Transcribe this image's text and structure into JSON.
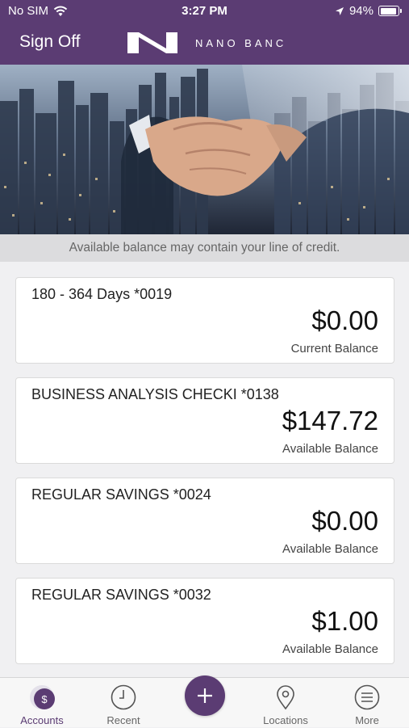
{
  "status_bar": {
    "carrier": "No SIM",
    "time": "3:27 PM",
    "battery_percent": "94%",
    "battery_level": 0.94,
    "icons": [
      "wifi-icon",
      "location-arrow-icon",
      "battery-icon"
    ]
  },
  "header": {
    "sign_off_label": "Sign Off",
    "brand_name": "NANO BANC",
    "color": "#5b3c73"
  },
  "hero": {
    "image": "city-skyline-handshake-photo"
  },
  "credit_note": "Available balance may contain your line of credit.",
  "accounts": [
    {
      "name": "180 - 364 Days *0019",
      "amount": "$0.00",
      "label": "Current Balance"
    },
    {
      "name": "BUSINESS ANALYSIS CHECKI *0138",
      "amount": "$147.72",
      "label": "Available Balance"
    },
    {
      "name": "REGULAR SAVINGS *0024",
      "amount": "$0.00",
      "label": "Available Balance"
    },
    {
      "name": "REGULAR SAVINGS *0032",
      "amount": "$1.00",
      "label": "Available Balance"
    }
  ],
  "tabbar": {
    "tabs": [
      {
        "label": "Accounts",
        "icon": "accounts-dollar-icon",
        "active": true
      },
      {
        "label": "Recent",
        "icon": "clock-icon",
        "active": false
      },
      {
        "label": "Locations",
        "icon": "map-pin-icon",
        "active": false
      },
      {
        "label": "More",
        "icon": "menu-icon",
        "active": false
      }
    ],
    "fab_icon": "plus-icon"
  }
}
